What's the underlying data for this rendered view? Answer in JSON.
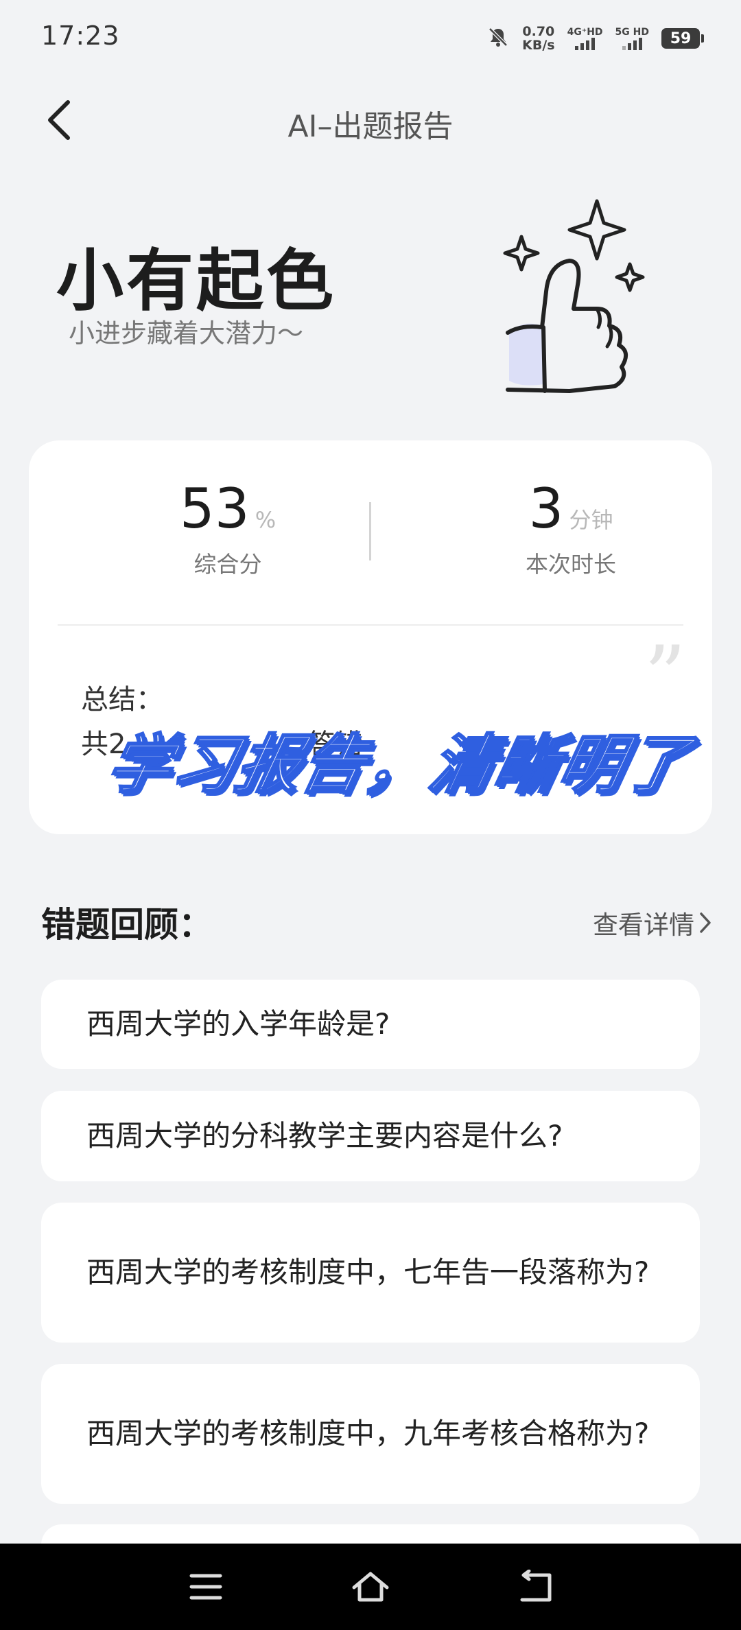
{
  "status_bar": {
    "time": "17:23",
    "net_speed_value": "0.70",
    "net_speed_unit": "KB/s",
    "sim1_label": "4G⁺HD",
    "sim2_label": "5G HD",
    "battery": "59"
  },
  "header": {
    "title": "AI–出题报告"
  },
  "hero": {
    "title": "小有起色",
    "subtitle": "小进步藏着大潜力～"
  },
  "score_card": {
    "score_value": "53",
    "score_unit": "%",
    "score_label": "综合分",
    "duration_value": "3",
    "duration_unit": "分钟",
    "duration_label": "本次时长",
    "summary_label": "总结：",
    "summary_text_start": "共2",
    "summary_text_end": "答错"
  },
  "overlay": {
    "caption": "学习报告，清晰明了"
  },
  "review": {
    "title": "错题回顾：",
    "detail_link": "查看详情",
    "questions": [
      {
        "text": "西周大学的入学年龄是?"
      },
      {
        "text": "西周大学的分科教学主要内容是什么?"
      },
      {
        "text": "西周大学的考核制度中，七年告一段落称为?"
      },
      {
        "text": "西周大学的考核制度中，九年考核合格称为?"
      }
    ]
  },
  "colors": {
    "background": "#f2f3f5",
    "card": "#ffffff",
    "accent_blue": "#2f5fe0"
  }
}
